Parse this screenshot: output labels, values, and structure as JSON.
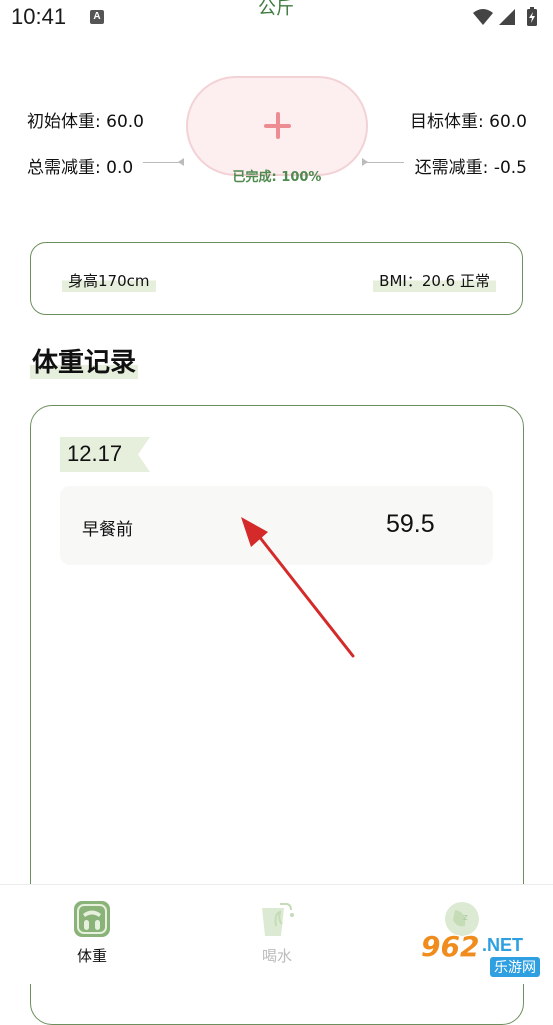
{
  "status_bar": {
    "time": "10:41",
    "notif_glyph": "A",
    "unit_label": "公斤"
  },
  "summary": {
    "initial_weight": "初始体重: 60.0",
    "target_weight": "目标体重: 60.0",
    "total_loss": "总需减重: 0.0",
    "remaining_loss": "还需减重: -0.5",
    "progress_text": "已完成: 100%",
    "progress_percent": 100,
    "add_icon": "plus-icon"
  },
  "info": {
    "height": "身高170cm",
    "bmi": "BMI：20.6 正常"
  },
  "records": {
    "title": "体重记录",
    "groups": [
      {
        "date": "12.17",
        "entries": [
          {
            "label": "早餐前",
            "value": "59.5"
          }
        ]
      }
    ]
  },
  "nav": {
    "items": [
      {
        "label": "体重",
        "icon": "scale-icon",
        "active": true
      },
      {
        "label": "喝水",
        "icon": "cup-icon",
        "active": false
      },
      {
        "label": "",
        "icon": "sleep-icon",
        "active": false
      }
    ]
  },
  "watermark": {
    "number": "962",
    "suffix": ".NET",
    "site_name": "乐游网"
  },
  "colors": {
    "accent": "#6d8f5e",
    "pink": "#ee8c93",
    "arrow": "#d42a2a",
    "highlight": "#e6eedc"
  }
}
